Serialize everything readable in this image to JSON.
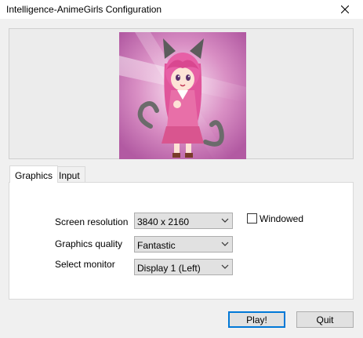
{
  "window": {
    "title": "Intelligence-AnimeGirls Configuration"
  },
  "banner": {
    "image": "anime-girl-cat-ears-pink-hair"
  },
  "tabs": [
    {
      "label": "Graphics",
      "active": true
    },
    {
      "label": "Input",
      "active": false
    }
  ],
  "graphics": {
    "screen_resolution": {
      "label": "Screen resolution",
      "value": "3840 x 2160"
    },
    "windowed": {
      "label": "Windowed",
      "checked": false
    },
    "graphics_quality": {
      "label": "Graphics quality",
      "value": "Fantastic"
    },
    "select_monitor": {
      "label": "Select monitor",
      "value": "Display 1 (Left)"
    }
  },
  "buttons": {
    "play": "Play!",
    "quit": "Quit"
  },
  "colors": {
    "accent": "#0078d7",
    "background": "#f0f0f0",
    "panel": "#ffffff"
  }
}
